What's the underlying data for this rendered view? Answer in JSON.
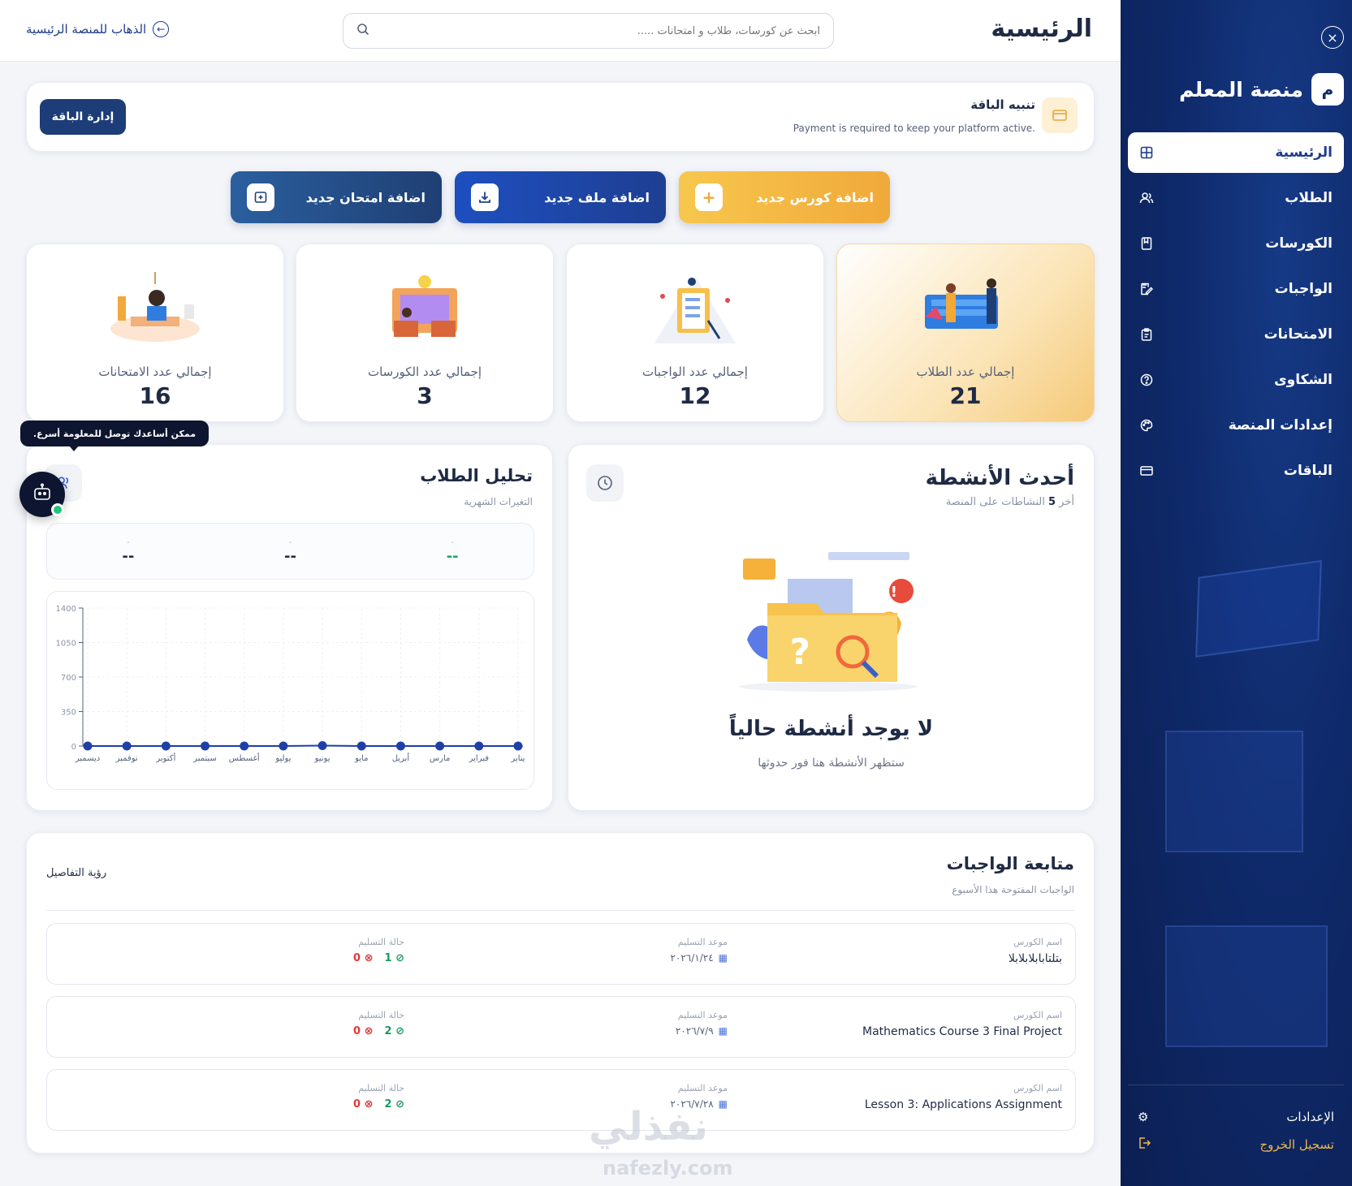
{
  "header": {
    "title": "الرئيسية",
    "search_placeholder": "ابحث عن كورسات، طلاب و امتحانات .....",
    "go_home": "الذهاب للمنصة الرئيسية"
  },
  "sidebar": {
    "logo_letter": "م",
    "brand": "منصة المعلم",
    "items": [
      {
        "label": "الرئيسية",
        "icon": "grid-icon",
        "active": true
      },
      {
        "label": "الطلاب",
        "icon": "users-icon"
      },
      {
        "label": "الكورسات",
        "icon": "book-icon"
      },
      {
        "label": "الواجبات",
        "icon": "edit-icon"
      },
      {
        "label": "الامتحانات",
        "icon": "clipboard-icon"
      },
      {
        "label": "الشكاوى",
        "icon": "help-circle-icon"
      },
      {
        "label": "إعدادات المنصة",
        "icon": "palette-icon"
      },
      {
        "label": "الباقات",
        "icon": "card-icon"
      }
    ],
    "settings": "الإعدادات",
    "logout": "تسجيل الخروج"
  },
  "alert": {
    "title": "تنبيه الباقة",
    "message": "Payment is required to keep your platform active.",
    "button": "إدارة الباقة"
  },
  "quick_actions": {
    "course": "اضافة كورس جديد",
    "file": "اضافة ملف جديد",
    "exam": "اضافة امتحان جديد"
  },
  "stats": [
    {
      "label": "إجمالي عدد الطلاب",
      "value": "21"
    },
    {
      "label": "إجمالي عدد الواجبات",
      "value": "12"
    },
    {
      "label": "إجمالي عدد الكورسات",
      "value": "3"
    },
    {
      "label": "إجمالي عدد الامتحانات",
      "value": "16"
    }
  ],
  "activities": {
    "title": "أحدث الأنشطة",
    "subtitle_prefix": "أخر",
    "subtitle_count": "5",
    "subtitle_suffix": "النشاطات على المنصة",
    "empty_title": "لا يوجد أنشطة حالياً",
    "empty_sub": "ستظهر الأنشطة هنا فور حدوثها"
  },
  "analysis": {
    "title": "تحليل الطلاب",
    "subtitle": "التغيرات الشهرية",
    "metrics": [
      {
        "tick": "-",
        "value": "--",
        "color": "green"
      },
      {
        "tick": "-",
        "value": "--",
        "color": "dark"
      },
      {
        "tick": "-",
        "value": "--",
        "color": "dark"
      }
    ]
  },
  "chart_data": {
    "type": "line",
    "categories": [
      "يناير",
      "فبراير",
      "مارس",
      "أبريل",
      "مايو",
      "يونيو",
      "يوليو",
      "أغسطس",
      "سبتمبر",
      "أكتوبر",
      "نوفمبر",
      "ديسمبر"
    ],
    "series": [
      {
        "values": [
          0,
          0,
          0,
          0,
          0,
          4,
          0,
          0,
          0,
          0,
          0,
          0
        ]
      }
    ],
    "ylim": [
      0,
      1400
    ],
    "yticks": [
      0,
      350,
      700,
      1050,
      1400
    ],
    "grid": true,
    "color": "#1f3fa8"
  },
  "assistant": {
    "tooltip": "ممكن أساعدك توصل للمعلومة أسرع."
  },
  "homework": {
    "title": "متابعة الواجبات",
    "subtitle": "الواجبات المفتوحة هذا الأسبوع",
    "details_link": "رؤية التفاصيل",
    "col_name": "اسم الكورس",
    "col_date": "موعد التسليم",
    "col_status": "حالة التسليم",
    "rows": [
      {
        "name": "بتلتابابلابلابلا",
        "date": "٢٠٢٦/١/٢٤",
        "submitted": "1",
        "missing": "0"
      },
      {
        "name": "Mathematics Course 3 Final Project",
        "date": "٢٠٢٦/٧/٩",
        "submitted": "2",
        "missing": "0"
      },
      {
        "name": "Lesson 3: Applications Assignment",
        "date": "٢٠٢٦/٧/٢٨",
        "submitted": "2",
        "missing": "0"
      }
    ]
  },
  "watermark": {
    "text": "نفذلي",
    "sub": "nafezly.com"
  }
}
